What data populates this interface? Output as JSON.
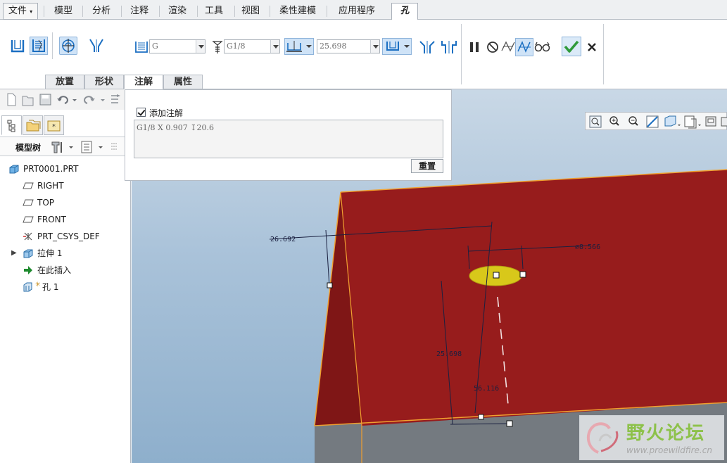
{
  "menu": {
    "file": "文件",
    "tabs": [
      "模型",
      "分析",
      "注释",
      "渲染",
      "工具",
      "视图",
      "柔性建模",
      "应用程序"
    ],
    "active_tab": "孔"
  },
  "ribbon": {
    "thread_type": "G",
    "thread_size": "G1/8",
    "depth_value": "25.698",
    "subtabs": [
      "放置",
      "形状",
      "注解",
      "属性"
    ],
    "active_subtab": "注解"
  },
  "annotation_panel": {
    "add_note_label": "添加注解",
    "add_note_checked": true,
    "note_text": "G1/8 X 0.907 ↧20.6",
    "reset_label": "重置"
  },
  "model_tree": {
    "toolbar_label": "模型树",
    "items": [
      {
        "label": "PRT0001.PRT",
        "icon": "part-icon"
      },
      {
        "label": "RIGHT",
        "icon": "datum-plane-icon"
      },
      {
        "label": "TOP",
        "icon": "datum-plane-icon"
      },
      {
        "label": "FRONT",
        "icon": "datum-plane-icon"
      },
      {
        "label": "PRT_CSYS_DEF",
        "icon": "csys-icon"
      },
      {
        "label": "拉伸 1",
        "icon": "extrude-icon"
      },
      {
        "label": "在此插入",
        "icon": "insert-here-arrow-icon"
      },
      {
        "label": "孔 1",
        "icon": "hole-icon"
      }
    ]
  },
  "viewport": {
    "dimensions": {
      "offset_left": "26.692",
      "diameter": "⌀8.566",
      "offset_bottom": "25.698",
      "angle": "56.116"
    }
  },
  "watermark": {
    "title": "野火论坛",
    "url": "www.proewildfire.cn"
  },
  "colors": {
    "solid_face": "#971c1c",
    "solid_edge": "#f0a030",
    "hole_fill": "#d8c81a",
    "dimension_line": "#1a2040",
    "selection_highlight": "#cfe3f7",
    "confirm_green": "#2f9a3a"
  }
}
